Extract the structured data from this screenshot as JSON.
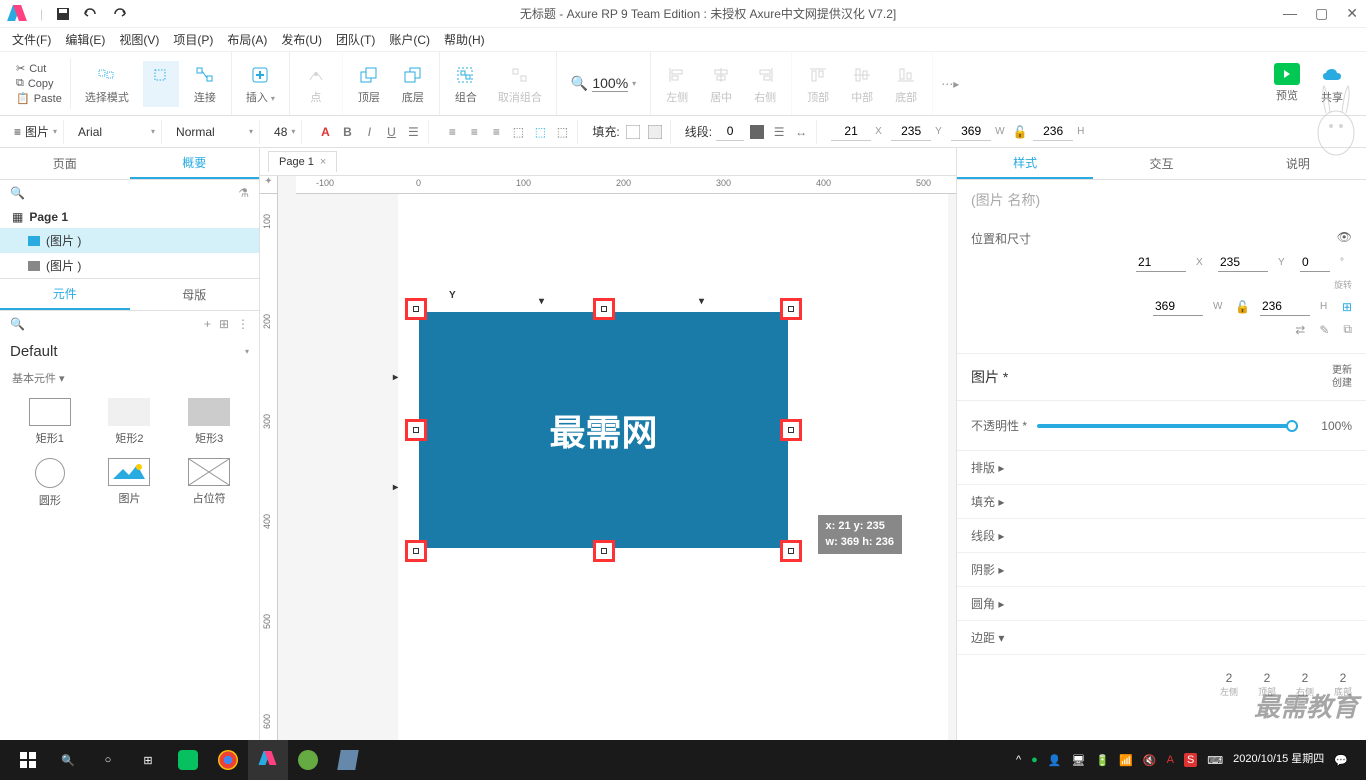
{
  "title": "无标题 - Axure RP 9 Team Edition : 未授权    Axure中文网提供汉化  V7.2]",
  "menu": [
    "文件(F)",
    "编辑(E)",
    "视图(V)",
    "项目(P)",
    "布局(A)",
    "发布(U)",
    "团队(T)",
    "账户(C)",
    "帮助(H)"
  ],
  "clipboard": {
    "cut": "Cut",
    "copy": "Copy",
    "paste": "Paste"
  },
  "ribbon": {
    "select_mode": "选择模式",
    "connect": "连接",
    "insert": "插入",
    "point": "点",
    "front": "顶层",
    "back": "底层",
    "group": "组合",
    "ungroup": "取消组合",
    "zoom": "100%",
    "align_left": "左侧",
    "align_center": "居中",
    "align_right": "右侧",
    "align_top": "顶部",
    "align_middle": "中部",
    "align_bottom": "底部",
    "preview": "预览",
    "share": "共享"
  },
  "format": {
    "style_type": "图片",
    "font": "Arial",
    "weight": "Normal",
    "size": "48",
    "fill_label": "填充:",
    "line_label": "线段:",
    "line_width": "0",
    "x": "21",
    "x_lbl": "X",
    "y": "235",
    "y_lbl": "Y",
    "w": "369",
    "w_lbl": "W",
    "h": "236",
    "h_lbl": "H"
  },
  "left": {
    "tab_page": "页面",
    "tab_outline": "概要",
    "page1": "Page 1",
    "img1": "(图片 )",
    "img2": "(图片 )",
    "tab_widgets": "元件",
    "tab_masters": "母版",
    "lib": "Default",
    "section": "基本元件 ▾",
    "widgets": [
      "矩形1",
      "矩形2",
      "矩形3",
      "圆形",
      "图片",
      "占位符"
    ]
  },
  "canvas": {
    "page_tab": "Page 1",
    "ruler_h": [
      "-100",
      "0",
      "100",
      "200",
      "300",
      "400",
      "500"
    ],
    "ruler_v": [
      "100",
      "200",
      "300",
      "400",
      "500",
      "600"
    ],
    "image_text": "最需网",
    "tooltip": {
      "line1": "x: 21    y: 235",
      "line2": "w: 369  h: 236"
    }
  },
  "right": {
    "tab_style": "样式",
    "tab_interact": "交互",
    "tab_notes": "说明",
    "name_placeholder": "(图片 名称)",
    "section_pos": "位置和尺寸",
    "x": "21",
    "y": "235",
    "rot": "0",
    "w": "369",
    "h": "236",
    "rot_label": "旋转",
    "section_image": "图片 *",
    "update": "更新",
    "create": "创建",
    "opacity_label": "不透明性 *",
    "opacity": "100%",
    "sections": [
      "排版 ▸",
      "填充 ▸",
      "线段 ▸",
      "阴影 ▸",
      "圆角 ▸",
      "边距 ▾"
    ],
    "padding": {
      "values": [
        "2",
        "2",
        "2",
        "2"
      ],
      "labels": [
        "左侧",
        "顶部",
        "右侧",
        "底部"
      ]
    }
  },
  "taskbar": {
    "date": "2020/10/15 星期四"
  },
  "watermark": "最需教育"
}
